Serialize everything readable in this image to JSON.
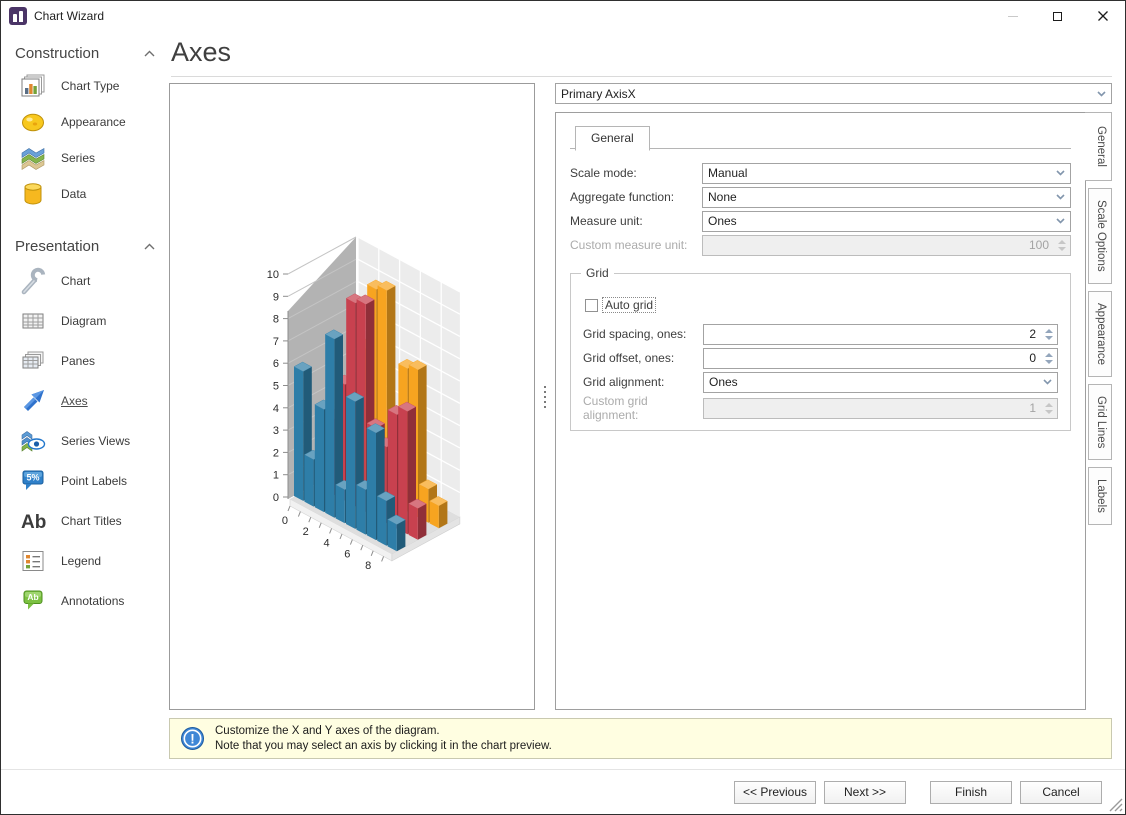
{
  "window": {
    "title": "Chart Wizard"
  },
  "sidebar": {
    "sections": [
      {
        "label": "Construction",
        "items": [
          {
            "label": "Chart Type",
            "icon": "chart-type-icon"
          },
          {
            "label": "Appearance",
            "icon": "appearance-icon"
          },
          {
            "label": "Series",
            "icon": "series-icon"
          },
          {
            "label": "Data",
            "icon": "data-icon"
          }
        ]
      },
      {
        "label": "Presentation",
        "items": [
          {
            "label": "Chart",
            "icon": "wrench-icon"
          },
          {
            "label": "Diagram",
            "icon": "diagram-icon"
          },
          {
            "label": "Panes",
            "icon": "panes-icon"
          },
          {
            "label": "Axes",
            "icon": "axes-arrow-icon",
            "selected": true
          },
          {
            "label": "Series Views",
            "icon": "series-views-icon"
          },
          {
            "label": "Point Labels",
            "icon": "point-labels-icon"
          },
          {
            "label": "Chart Titles",
            "icon": "chart-titles-icon"
          },
          {
            "label": "Legend",
            "icon": "legend-icon"
          },
          {
            "label": "Annotations",
            "icon": "annotations-icon"
          }
        ]
      }
    ]
  },
  "page": {
    "title": "Axes"
  },
  "axis_selector": {
    "value": "Primary AxisX"
  },
  "tab_strip": {
    "active": "General",
    "horizontal": [
      "General"
    ],
    "vertical": [
      "General",
      "Scale Options",
      "Appearance",
      "Grid Lines",
      "Labels"
    ]
  },
  "form": {
    "scale_mode": {
      "label": "Scale mode:",
      "value": "Manual"
    },
    "aggregate_function": {
      "label": "Aggregate function:",
      "value": "None"
    },
    "measure_unit": {
      "label": "Measure unit:",
      "value": "Ones"
    },
    "custom_measure_unit": {
      "label": "Custom measure unit:",
      "value": "100",
      "disabled": true
    },
    "grid_group": {
      "label": "Grid",
      "auto_grid": {
        "label": "Auto grid",
        "checked": false
      },
      "grid_spacing": {
        "label": "Grid spacing, ones:",
        "value": "2"
      },
      "grid_offset": {
        "label": "Grid offset, ones:",
        "value": "0"
      },
      "grid_alignment": {
        "label": "Grid alignment:",
        "value": "Ones"
      },
      "custom_grid_alignment": {
        "label": "Custom grid alignment:",
        "value": "1",
        "disabled": true
      }
    }
  },
  "info_bar": {
    "line1": "Customize the X and Y axes of the diagram.",
    "line2": "Note that you may select an axis by clicking it in the chart preview."
  },
  "footer": {
    "previous": "<< Previous",
    "next": "Next >>",
    "finish": "Finish",
    "cancel": "Cancel"
  },
  "colors": {
    "series_blue": "#2e7ea8",
    "series_red": "#c8414f",
    "series_orange": "#f7a420",
    "info_bg": "#fffee1",
    "wall_left": "#b3b3b3",
    "wall_back": "#ececec"
  },
  "chart_data": {
    "type": "bar",
    "variant": "3d-manhattan-preview",
    "x": [
      0,
      1,
      2,
      3,
      4,
      5,
      6,
      7,
      8,
      9
    ],
    "x_ticks": [
      0,
      2,
      4,
      6,
      8
    ],
    "y_ticks": [
      0,
      1,
      2,
      3,
      4,
      5,
      6,
      7,
      8,
      9,
      10
    ],
    "ylim": [
      0,
      10
    ],
    "grid": true,
    "series": [
      {
        "name": "series-blue",
        "color": "#2e7ea8",
        "values": [
          5.8,
          2.1,
          4.6,
          8.0,
          1.5,
          5.7,
          2.0,
          4.8,
          2.0,
          1.2
        ]
      },
      {
        "name": "series-red",
        "color": "#c8414f",
        "values": [
          2.9,
          3.4,
          5.2,
          9.1,
          9.3,
          4.0,
          3.4,
          5.1,
          5.5,
          1.4
        ]
      },
      {
        "name": "series-orange",
        "color": "#f7a420",
        "values": [
          2.2,
          3.5,
          6.3,
          9.2,
          9.4,
          2.6,
          6.4,
          6.6,
          1.5,
          1.0
        ]
      }
    ]
  }
}
